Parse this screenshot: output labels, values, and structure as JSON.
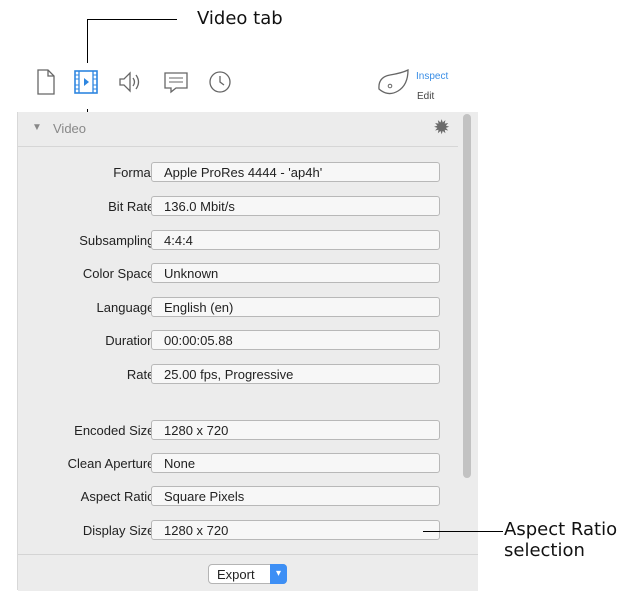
{
  "callouts": {
    "video_tab": "Video tab",
    "aspect_ratio_line1": "Aspect Ratio",
    "aspect_ratio_line2": "selection"
  },
  "toolbar": {
    "tabs": [
      {
        "icon": "document-icon"
      },
      {
        "icon": "film-icon"
      },
      {
        "icon": "speaker-icon"
      },
      {
        "icon": "caption-icon"
      },
      {
        "icon": "clock-icon"
      }
    ],
    "inspect_label": "Inspect",
    "edit_label": "Edit",
    "accent_color": "#3a8ee6"
  },
  "section": {
    "title": "Video"
  },
  "fields": [
    {
      "label": "Format:",
      "value": "Apple ProRes 4444 - 'ap4h'"
    },
    {
      "label": "Bit Rate:",
      "value": "136.0 Mbit/s"
    },
    {
      "label": "Subsampling:",
      "value": "4:4:4"
    },
    {
      "label": "Color Space:",
      "value": "Unknown"
    },
    {
      "label": "Language:",
      "value": "English (en)"
    },
    {
      "label": "Duration:",
      "value": "00:00:05.88"
    },
    {
      "label": "Rate:",
      "value": "25.00 fps, Progressive"
    },
    {
      "label": "Encoded Size:",
      "value": "1280 x 720"
    },
    {
      "label": "Clean Aperture:",
      "value": "None"
    },
    {
      "label": "Aspect Ratio:",
      "value": "Square Pixels"
    },
    {
      "label": "Display Size:",
      "value": "1280 x 720"
    }
  ],
  "export": {
    "label": "Export"
  }
}
